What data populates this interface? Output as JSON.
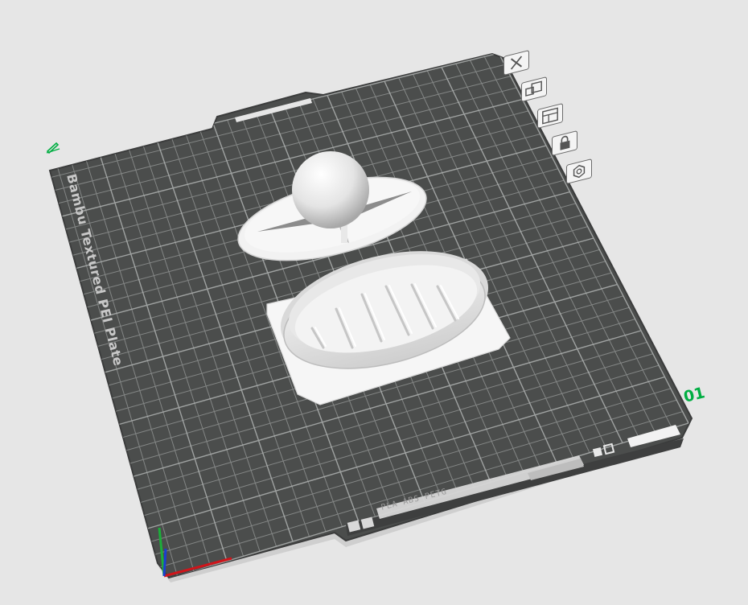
{
  "plate": {
    "number": "01",
    "name": "Bambu Textured PEI Plate",
    "filament_types": "PLA ABS PETG"
  },
  "plate_tools": [
    {
      "name": "delete-plate-icon",
      "icon": "close-icon"
    },
    {
      "name": "arrange-plate-icon",
      "icon": "arrange-icon"
    },
    {
      "name": "orient-plate-icon",
      "icon": "layout-icon"
    },
    {
      "name": "lock-plate-icon",
      "icon": "lock-icon"
    },
    {
      "name": "plate-settings-icon",
      "icon": "hexagon-icon"
    }
  ],
  "colors": {
    "background": "#e6e6e6",
    "plate": "#4b4d4c",
    "grid": "#8e9190",
    "accent": "#00ae42",
    "model": "#f2f2f2"
  }
}
